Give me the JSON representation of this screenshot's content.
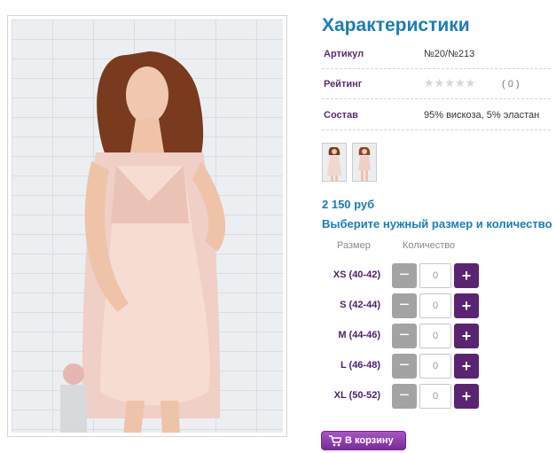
{
  "product": {
    "title": "Характеристики",
    "specs": [
      {
        "label": "Артикул",
        "value": "№20/№213"
      },
      {
        "label": "Рейтинг",
        "stars": "★★★★★",
        "count": "( 0 )"
      },
      {
        "label": "Состав",
        "value": "95% вискоза, 5% эластан"
      }
    ],
    "price": "2 150 руб",
    "prompt": "Выберите нужный размер и количество",
    "size_header": "Размер",
    "qty_header": "Количество",
    "sizes": [
      {
        "label": "XS (40-42)",
        "qty": "0"
      },
      {
        "label": "S (42-44)",
        "qty": "0"
      },
      {
        "label": "M (44-46)",
        "qty": "0"
      },
      {
        "label": "L (46-48)",
        "qty": "0"
      },
      {
        "label": "XL (50-52)",
        "qty": "0"
      }
    ],
    "minus_label": "−",
    "plus_label": "+",
    "cart_label": "В корзину"
  },
  "colors": {
    "heading": "#1a7db5",
    "label": "#5a2d74",
    "plus_button": "#5a2472",
    "minus_button": "#a3a3a3",
    "cart_button": "#8f3db0"
  },
  "icons": [
    "cart-icon"
  ]
}
